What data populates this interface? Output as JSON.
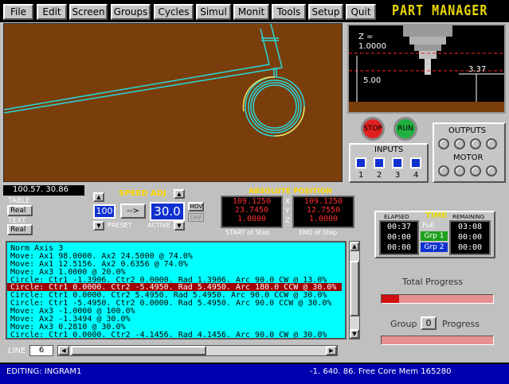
{
  "menu": {
    "items": [
      "File",
      "Edit",
      "Screen",
      "Groups",
      "Cycles",
      "Simul",
      "Monit",
      "Tools",
      "Setup",
      "Quit"
    ]
  },
  "app_title": "PART MANAGER",
  "machine_view": {
    "z_label": "Z =",
    "z_value": "1.0000",
    "dim_a": "3.37",
    "dim_b": "5.00"
  },
  "controls": {
    "stop": "STOP",
    "run": "RUN"
  },
  "inputs": {
    "title": "INPUTS",
    "numbers": [
      "1",
      "2",
      "3",
      "4"
    ]
  },
  "outputs": {
    "title": "OUTPUTS",
    "motor_label": "MOTOR"
  },
  "coord_readout": "100.57. 30.86",
  "table": {
    "table_label": "TABLE",
    "table_value": "Real",
    "text_label": "TEXT",
    "text_value": "Real"
  },
  "speed": {
    "title": "SPEED ADJ",
    "preset_value": "100",
    "arrow": "-->",
    "active_value": "30.0",
    "preset_label": "PRESET",
    "active_label": "ACTIVE",
    "mov_label": "MOV",
    "drp_label": "DRP"
  },
  "absolute_position": {
    "title": "ABSOLUTE POSITION",
    "start": [
      "109.1250",
      "23.7450",
      "1.0000"
    ],
    "end": [
      "109.1250",
      "12.7550",
      "1.0000"
    ],
    "axes": [
      "X",
      "Y",
      "Z"
    ],
    "start_label": "START of Step",
    "end_label": "END of Step"
  },
  "time": {
    "title": "TIME",
    "elapsed_label": "ELAPSED",
    "remaining_label": "REMAINING",
    "elapsed": [
      "00:37",
      "00:00",
      "00:00"
    ],
    "remaining": [
      "03:08",
      "00:00",
      "00:00"
    ],
    "full_label": "Full",
    "grp1_label": "Grp 1",
    "grp2_label": "Grp 2"
  },
  "program": {
    "lines": [
      "Norm Axis 3",
      "Move: Ax1 98.0000. Ax2 24.5000 @ 74.0%",
      "Move: Ax1 12.5156. Ax2 0.6356 @ 74.0%",
      "Move: Ax3 1.0000 @ 20.0%",
      "Circle: Ctr1 -1.3906. Ctr2 0.0000. Rad 1.3906. Arc 90.0 CW @ 13.0%",
      "Circle: Ctr1 0.0000. Ctr2 -5.4950. Rad 5.4950. Arc 180.0 CCW @ 30.0%",
      "Circle: Ctr1 0.0000. Ctr2 5.4950. Rad 5.4950. Arc 90.0 CCW @ 30.0%",
      "Circle: Ctr1 -5.4950. Ctr2 0.0000. Rad 5.4950. Arc 90.0 CCW @ 30.0%",
      "Move: Ax3 -1.0000 @ 100.0%",
      "Move: Ax2 -1.3494 @ 30.0%",
      "Move: Ax3 0.2810 @ 30.0%",
      "Circle: Ctr1 0.0000. Ctr2 -4.1456. Rad 4.1456. Arc 90.0 CW @ 30.0%"
    ],
    "selected_index": 5
  },
  "line": {
    "label": "LINE",
    "value": "6"
  },
  "progress": {
    "total_label": "Total Progress",
    "total_fraction": 0.16,
    "group_label": "Group",
    "group_value": "0",
    "progress_label": "Progress",
    "group_fraction": 0.0
  },
  "status": {
    "editing": "EDITING:  INGRAM1",
    "info": "-1. 640. 86. Free Core Mem 165280"
  },
  "colors": {
    "menubar": "#000000",
    "view_bg": "#7a3e0c",
    "toolpath": "#28d8d8",
    "list_bg": "#00ffff",
    "selected_row": "#a00000",
    "status_bg": "#0000b0"
  }
}
